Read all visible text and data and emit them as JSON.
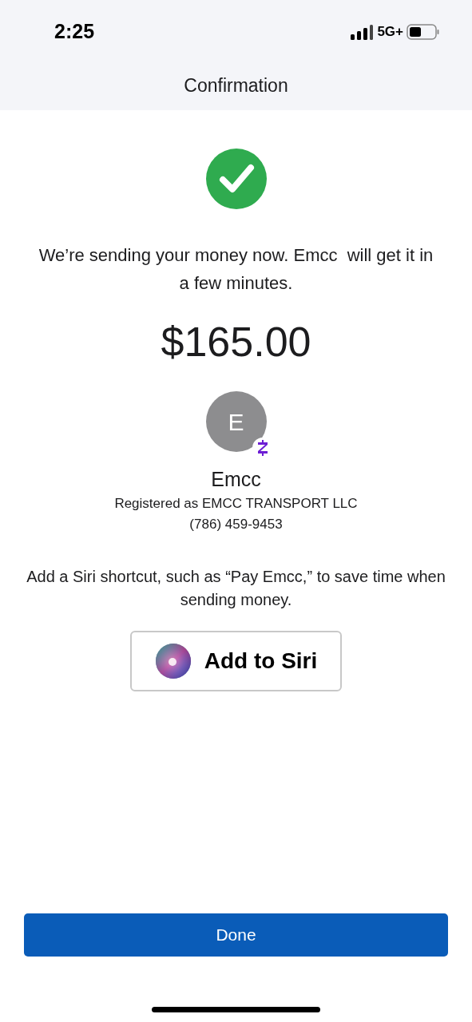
{
  "status_bar": {
    "time": "2:25",
    "network": "5G+"
  },
  "header": {
    "title": "Confirmation"
  },
  "confirmation": {
    "message": "We’re sending your money now. Emcc  will get it in a few minutes.",
    "amount": "$165.00"
  },
  "recipient": {
    "initial": "E",
    "name": "Emcc",
    "registered_as": "Registered as EMCC TRANSPORT LLC",
    "phone": "(786) 459-9453"
  },
  "siri": {
    "hint": "Add a Siri shortcut, such as “Pay Emcc,” to save time when sending money.",
    "button": "Add to Siri"
  },
  "done_button": "Done"
}
